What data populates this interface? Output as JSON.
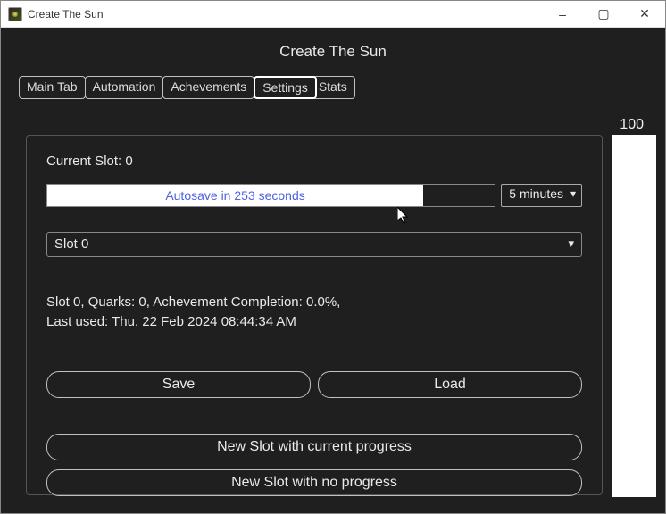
{
  "window": {
    "title": "Create The Sun",
    "app_title": "Create The Sun"
  },
  "tabs": {
    "main": "Main Tab",
    "automation": "Automation",
    "achievements": "Achevements",
    "settings": "Settings",
    "stats": "Stats",
    "selected": "settings"
  },
  "slot_display": {
    "current_slot_label": "Current Slot:",
    "current_slot_value": "0"
  },
  "autosave": {
    "label": "Autosave in 253 seconds",
    "progress_pct": 84,
    "interval_selected": "5 minutes"
  },
  "slot_selector": {
    "selected": "Slot 0"
  },
  "slot_info": {
    "line1": "Slot 0, Quarks: 0, Achevement Completion: 0.0%,",
    "line2": "Last used: Thu, 22 Feb 2024 08:44:34 AM"
  },
  "buttons": {
    "save": "Save",
    "load": "Load",
    "new_slot_current": "New Slot with current progress",
    "new_slot_none": "New Slot with no progress"
  },
  "sidebar": {
    "value": "100"
  }
}
